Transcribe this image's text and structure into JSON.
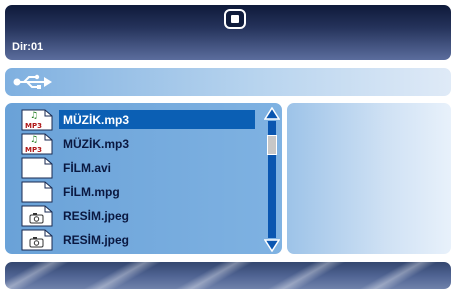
{
  "header": {
    "directory_label": "Dir:01",
    "stop_button_icon": "stop-icon"
  },
  "source": {
    "icon": "usb-icon"
  },
  "file_list": {
    "selected_index": 0,
    "items": [
      {
        "name": "MÜZİK.mp3",
        "type": "audio",
        "icon": "mp3-file-icon",
        "badge": "MP3"
      },
      {
        "name": "MÜZİK.mp3",
        "type": "audio",
        "icon": "mp3-file-icon",
        "badge": "MP3"
      },
      {
        "name": "FİLM.avi",
        "type": "video",
        "icon": "blank-file-icon"
      },
      {
        "name": "FİLM.mpg",
        "type": "video",
        "icon": "blank-file-icon"
      },
      {
        "name": "RESİM.jpeg",
        "type": "image",
        "icon": "camera-file-icon"
      },
      {
        "name": "RESİM.jpeg",
        "type": "image",
        "icon": "camera-file-icon"
      }
    ]
  },
  "colors": {
    "selection": "#0b5fb4",
    "header_dark": "#0e1a3a",
    "panel_blue": "#7fb2e2"
  }
}
